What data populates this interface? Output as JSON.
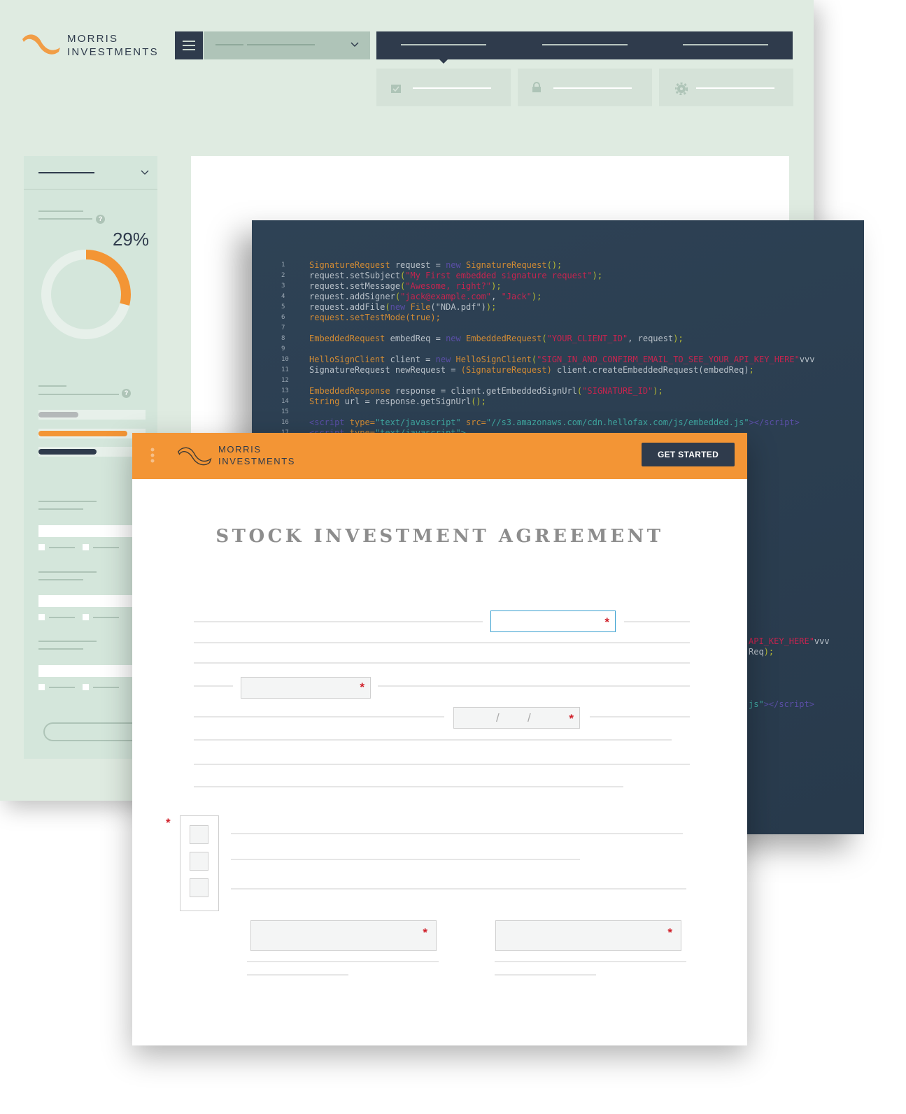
{
  "brand": {
    "line1": "MORRIS",
    "line2": "INVESTMENTS",
    "accent": "#f39535",
    "dark": "#2f3b4c",
    "mint": "#dfebe1"
  },
  "dashboard": {
    "menu_icon": "hamburger-icon",
    "subtabs": [
      {
        "icon": "calendar-check-icon"
      },
      {
        "icon": "lock-icon"
      },
      {
        "icon": "gear-icon"
      }
    ],
    "sidebar": {
      "percent_label": "29%",
      "percent": 29,
      "help_icon": "?",
      "bars": [
        {
          "fraction": 0.37,
          "color": "#b4b8b9"
        },
        {
          "fraction": 0.83,
          "color": "#f39535"
        },
        {
          "fraction": 0.54,
          "color": "#2f3b4c"
        }
      ]
    }
  },
  "code": {
    "lines": [
      [
        [
          "SignatureRequest",
          "type"
        ],
        [
          " request = ",
          "plain"
        ],
        [
          "new",
          "new"
        ],
        [
          " SignatureRequest",
          "type"
        ],
        [
          "();",
          "paren"
        ]
      ],
      [
        [
          "request.setSubject",
          "plain"
        ],
        [
          "(",
          "paren"
        ],
        [
          "\"My First embedded signature request\"",
          "str"
        ],
        [
          ");",
          "paren"
        ]
      ],
      [
        [
          "request.setMessage",
          "plain"
        ],
        [
          "(",
          "paren"
        ],
        [
          "\"Awesome, right?\"",
          "str"
        ],
        [
          ");",
          "paren"
        ]
      ],
      [
        [
          "request.addSigner",
          "plain"
        ],
        [
          "(",
          "paren"
        ],
        [
          "\"jack@example.com\"",
          "str"
        ],
        [
          ", ",
          "plain"
        ],
        [
          "\"Jack\"",
          "str"
        ],
        [
          ");",
          "paren"
        ]
      ],
      [
        [
          "request.addFile",
          "plain"
        ],
        [
          "(",
          "paren"
        ],
        [
          "new",
          "new"
        ],
        [
          " File",
          "type"
        ],
        [
          "(\"NDA.pdf\")",
          "plain"
        ],
        [
          ");",
          "paren"
        ]
      ],
      [
        [
          "request.setTestMode(true);",
          "type"
        ]
      ],
      [],
      [
        [
          "EmbeddedRequest",
          "type"
        ],
        [
          " embedReq = ",
          "plain"
        ],
        [
          "new",
          "new"
        ],
        [
          " EmbeddedRequest",
          "type"
        ],
        [
          "(",
          "paren"
        ],
        [
          "\"YOUR_CLIENT_ID\"",
          "str"
        ],
        [
          ", request",
          "plain"
        ],
        [
          ");",
          "paren"
        ]
      ],
      [],
      [
        [
          "HelloSignClient",
          "type"
        ],
        [
          " client = ",
          "plain"
        ],
        [
          "new",
          "new"
        ],
        [
          " HelloSignClient",
          "type"
        ],
        [
          "(",
          "paren"
        ],
        [
          "\"SIGN_IN_AND_CONFIRM_EMAIL_TO_SEE_YOUR_API_KEY_HERE\"",
          "str"
        ],
        [
          "vvv",
          "plain"
        ]
      ],
      [
        [
          "SignatureRequest newRequest = ",
          "plain"
        ],
        [
          "(SignatureRequest)",
          "type"
        ],
        [
          " client.createEmbeddedRequest(embedReq)",
          "plain"
        ],
        [
          ";",
          "paren"
        ]
      ],
      [],
      [
        [
          "EmbeddedResponse",
          "type"
        ],
        [
          " response = client.getEmbeddedSignUrl",
          "plain"
        ],
        [
          "(",
          "paren"
        ],
        [
          "\"SIGNATURE_ID\"",
          "str"
        ],
        [
          ");",
          "paren"
        ]
      ],
      [
        [
          "String",
          "type"
        ],
        [
          " url = response.getSignUrl",
          "plain"
        ],
        [
          "();",
          "paren"
        ]
      ],
      [],
      [
        [
          "<script",
          "tag"
        ],
        [
          " type=",
          "attr"
        ],
        [
          "\"text/javascript\"",
          "teal"
        ],
        [
          " src=",
          "attr"
        ],
        [
          "\"//s3.amazonaws.com/cdn.hellofax.com/js/embedded.js\"",
          "teal"
        ],
        [
          "></script>",
          "tag"
        ]
      ],
      [
        [
          "<script",
          "tag"
        ],
        [
          " type=",
          "attr"
        ],
        [
          "\"text/javascript\">",
          "teal"
        ]
      ]
    ],
    "echo": [
      [
        [
          "API_KEY_HERE\"",
          "str"
        ],
        [
          "vvv",
          "plain"
        ]
      ],
      [
        [
          "Req",
          "plain"
        ],
        [
          ");",
          "paren"
        ]
      ],
      [
        [
          "js\"",
          "teal"
        ],
        [
          "></script>",
          "tag"
        ]
      ]
    ]
  },
  "form": {
    "title": "STOCK INVESTMENT AGREEMENT",
    "get_started": "GET STARTED",
    "required_mark": "*",
    "date_sep": "/",
    "kebab_icon": "more-vertical-icon"
  }
}
